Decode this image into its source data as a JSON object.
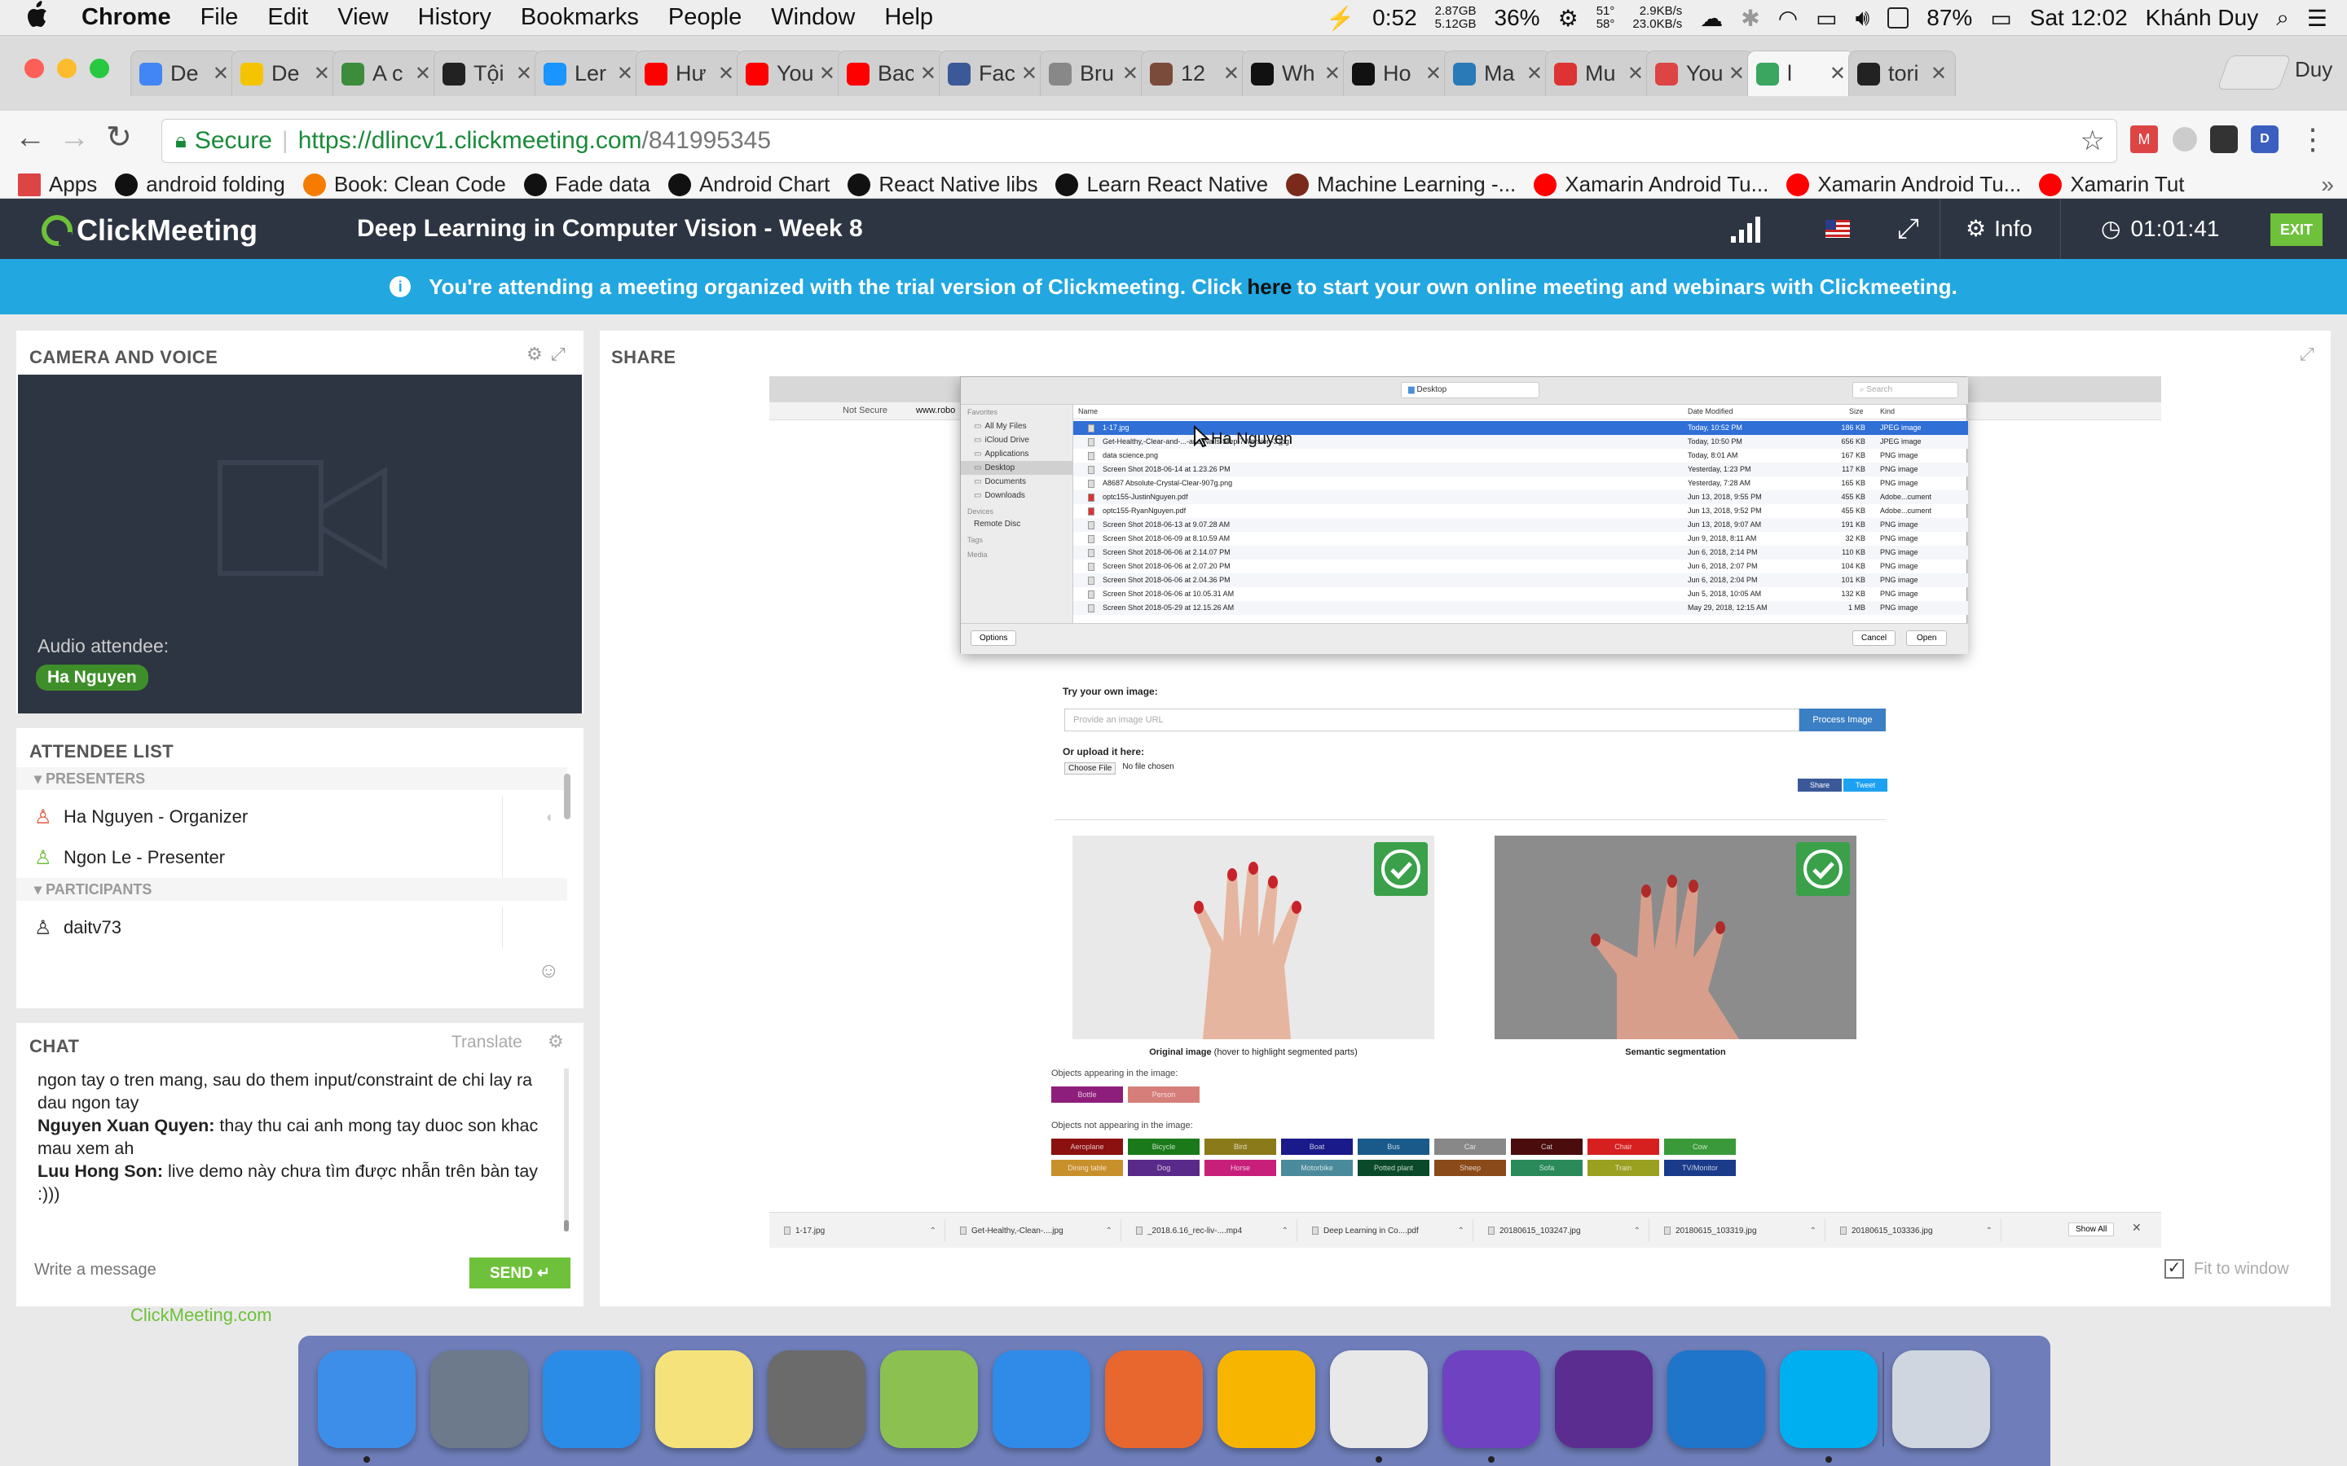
{
  "menubar": {
    "app": "Chrome",
    "items": [
      "File",
      "Edit",
      "View",
      "History",
      "Bookmarks",
      "People",
      "Window",
      "Help"
    ],
    "battery_time": "0:52",
    "mem_top": "2.87GB",
    "mem_bottom": "5.12GB",
    "cpu": "36%",
    "temp_top": "51°",
    "temp_bottom": "58°",
    "net_up": "2.9KB/s",
    "net_down": "23.0KB/s",
    "battery": "87%",
    "clock": "Sat 12:02",
    "user": "Khánh Duy"
  },
  "tabs": [
    {
      "title": "De",
      "color": "#4285f4"
    },
    {
      "title": "De",
      "color": "#f5c400"
    },
    {
      "title": "A c",
      "color": "#3c8c3c"
    },
    {
      "title": "Tội",
      "color": "#222222"
    },
    {
      "title": "Ler",
      "color": "#1a94ff"
    },
    {
      "title": "Hư",
      "color": "#ff0000"
    },
    {
      "title": "You",
      "color": "#ff0000"
    },
    {
      "title": "Bac",
      "color": "#ff0000"
    },
    {
      "title": "Fac",
      "color": "#3b5998"
    },
    {
      "title": "Bru",
      "color": "#888888"
    },
    {
      "title": "12",
      "color": "#7a4a3a"
    },
    {
      "title": "Wh",
      "color": "#111111"
    },
    {
      "title": "Ho",
      "color": "#111111"
    },
    {
      "title": "Ma",
      "color": "#2a7ab8"
    },
    {
      "title": "Mu",
      "color": "#d33"
    },
    {
      "title": "You",
      "color": "#d44"
    },
    {
      "title": "l",
      "color": "#3aa660",
      "active": true
    },
    {
      "title": "tori",
      "color": "#222222"
    }
  ],
  "profile": "Duy",
  "url": {
    "secure_label": "Secure",
    "prefix": "https://dlincv1.clickmeeting.com",
    "path": "/841995345"
  },
  "bookmarks": [
    {
      "label": "Apps",
      "color": "#d44"
    },
    {
      "label": "android folding",
      "color": "#111"
    },
    {
      "label": "Book: Clean Code",
      "color": "#f57c00"
    },
    {
      "label": "Fade data",
      "color": "#111"
    },
    {
      "label": "Android Chart",
      "color": "#111"
    },
    {
      "label": "React Native libs",
      "color": "#111"
    },
    {
      "label": "Learn React Native",
      "color": "#111"
    },
    {
      "label": "Machine Learning -...",
      "color": "#7a2a1a"
    },
    {
      "label": "Xamarin Android Tu...",
      "color": "#ff0000"
    },
    {
      "label": "Xamarin Android Tu...",
      "color": "#ff0000"
    },
    {
      "label": "Xamarin Tut",
      "color": "#ff0000"
    }
  ],
  "app": {
    "logo": "ClickMeeting",
    "title": "Deep Learning in Computer Vision - Week 8",
    "info": "Info",
    "timer": "01:01:41",
    "exit": "EXIT"
  },
  "banner": {
    "before": "You're attending a meeting organized with the trial version of Clickmeeting. Click ",
    "link": "here",
    "after": " to start your own online meeting and webinars with Clickmeeting."
  },
  "camera": {
    "header": "CAMERA AND VOICE",
    "audio_label": "Audio attendee:",
    "audio_name": "Ha Nguyen"
  },
  "attendees": {
    "header": "ATTENDEE LIST",
    "presenters_label": "PRESENTERS",
    "participants_label": "PARTICIPANTS",
    "presenters": [
      "Ha Nguyen - Organizer",
      "Ngon Le - Presenter"
    ],
    "participants": [
      "daitv73"
    ]
  },
  "chat": {
    "header": "CHAT",
    "translate": "Translate",
    "placeholder": "Write a message",
    "send": "SEND",
    "messages": [
      {
        "author": "",
        "text": "ngon tay o tren mang, sau do them input/constraint de chi lay ra dau ngon tay"
      },
      {
        "author": "Nguyen Xuan Quyen:",
        "text": " thay thu cai anh mong tay duoc son khac mau xem ah"
      },
      {
        "author": "Luu Hong Son:",
        "text": " live demo này chưa tìm được nhẫn trên bàn tay :)))"
      }
    ]
  },
  "footer": {
    "link": "ClickMeeting.com"
  },
  "share": {
    "header": "SHARE",
    "fit_to_window": "Fit to window",
    "cursor_label": "Ha Nguyen",
    "dialog": {
      "location": "Desktop",
      "search_placeholder": "Search",
      "sidebar_favorites": "Favorites",
      "sidebar_items": [
        "All My Files",
        "iCloud Drive",
        "Applications",
        "Desktop",
        "Documents",
        "Downloads"
      ],
      "sidebar_devices": "Devices",
      "sidebar_device_item": "Remote Disc",
      "sidebar_tags": "Tags",
      "sidebar_media": "Media",
      "col_name": "Name",
      "col_date": "Date Modified",
      "col_size": "Size",
      "col_kind": "Kind",
      "files": [
        {
          "name": "1-17.jpg",
          "date": "Today, 10:52 PM",
          "size": "186 KB",
          "kind": "JPEG image",
          "selected": true
        },
        {
          "name": "Get-Healthy,-Clear-and-...-and-Nails-Step-7-Version-3.jpg",
          "date": "Today, 10:50 PM",
          "size": "656 KB",
          "kind": "JPEG image"
        },
        {
          "name": "data science.png",
          "date": "Today, 8:01 AM",
          "size": "167 KB",
          "kind": "PNG image"
        },
        {
          "name": "Screen Shot 2018-06-14 at 1.23.26 PM",
          "date": "Yesterday, 1:23 PM",
          "size": "117 KB",
          "kind": "PNG image"
        },
        {
          "name": "A8687 Absolute-Crystal-Clear-907g.png",
          "date": "Yesterday, 7:28 AM",
          "size": "165 KB",
          "kind": "PNG image"
        },
        {
          "name": "optc155-JustinNguyen.pdf",
          "date": "Jun 13, 2018, 9:55 PM",
          "size": "455 KB",
          "kind": "Adobe...cument"
        },
        {
          "name": "optc155-RyanNguyen.pdf",
          "date": "Jun 13, 2018, 9:52 PM",
          "size": "455 KB",
          "kind": "Adobe...cument"
        },
        {
          "name": "Screen Shot 2018-06-13 at 9.07.28 AM",
          "date": "Jun 13, 2018, 9:07 AM",
          "size": "191 KB",
          "kind": "PNG image"
        },
        {
          "name": "Screen Shot 2018-06-09 at 8.10.59 AM",
          "date": "Jun 9, 2018, 8:11 AM",
          "size": "32 KB",
          "kind": "PNG image"
        },
        {
          "name": "Screen Shot 2018-06-06 at 2.14.07 PM",
          "date": "Jun 6, 2018, 2:14 PM",
          "size": "110 KB",
          "kind": "PNG image"
        },
        {
          "name": "Screen Shot 2018-06-06 at 2.07.20 PM",
          "date": "Jun 6, 2018, 2:07 PM",
          "size": "104 KB",
          "kind": "PNG image"
        },
        {
          "name": "Screen Shot 2018-06-06 at 2.04.36 PM",
          "date": "Jun 6, 2018, 2:04 PM",
          "size": "101 KB",
          "kind": "PNG image"
        },
        {
          "name": "Screen Shot 2018-06-06 at 10.05.31 AM",
          "date": "Jun 5, 2018, 10:05 AM",
          "size": "132 KB",
          "kind": "PNG image"
        },
        {
          "name": "Screen Shot 2018-05-29 at 12.15.26 AM",
          "date": "May 29, 2018, 12:15 AM",
          "size": "1 MB",
          "kind": "PNG image"
        }
      ],
      "options": "Options",
      "cancel": "Cancel",
      "open": "Open"
    },
    "page": {
      "browser_url_prefix": "Not Secure",
      "browser_url": "www.robo",
      "try_label": "Try your own image:",
      "url_placeholder": "Provide an image URL",
      "process_button": "Process Image",
      "upload_label": "Or upload it here:",
      "choose_file": "Choose File",
      "no_file": "No file chosen",
      "share_fb": "Share",
      "share_tw": "Tweet",
      "orig_caption_bold": "Original image",
      "orig_caption_rest": " (hover to highlight segmented parts)",
      "seg_caption": "Semantic segmentation",
      "appearing_label": "Objects appearing in the image:",
      "appearing": [
        {
          "label": "Bottle",
          "color": "#8e1e7c"
        },
        {
          "label": "Person",
          "color": "#d67f7a"
        }
      ],
      "not_appearing_label": "Objects not appearing in the image:",
      "not_appearing": [
        {
          "label": "Aeroplane",
          "color": "#8b1010"
        },
        {
          "label": "Bicycle",
          "color": "#1a7a1a"
        },
        {
          "label": "Bird",
          "color": "#8a7a1a"
        },
        {
          "label": "Boat",
          "color": "#1a1a8a"
        },
        {
          "label": "Bus",
          "color": "#1a5a8a"
        },
        {
          "label": "Car",
          "color": "#888888"
        },
        {
          "label": "Cat",
          "color": "#4a0c0c"
        },
        {
          "label": "Chair",
          "color": "#d62020"
        },
        {
          "label": "Cow",
          "color": "#3a9a3a"
        },
        {
          "label": "Dining table",
          "color": "#c8902a"
        },
        {
          "label": "Dog",
          "color": "#5a2a8a"
        },
        {
          "label": "Horse",
          "color": "#c8207a"
        },
        {
          "label": "Motorbike",
          "color": "#4a8a9a"
        },
        {
          "label": "Potted plant",
          "color": "#0a4a2a"
        },
        {
          "label": "Sheep",
          "color": "#8a4a1a"
        },
        {
          "label": "Sofa",
          "color": "#2a8a5a"
        },
        {
          "label": "Train",
          "color": "#9aa020"
        },
        {
          "label": "TV/Monitor",
          "color": "#1a3a8a"
        }
      ],
      "downloads": [
        "1-17.jpg",
        "Get-Healthy,-Clean-....jpg",
        "_2018.6.16_rec-liv-....mp4",
        "Deep Learning in Co....pdf",
        "20180615_103247.jpg",
        "20180615_103319.jpg",
        "20180615_103336.jpg"
      ],
      "show_all": "Show All"
    }
  },
  "dock": [
    {
      "name": "finder",
      "color": "#3d8ee8",
      "running": true
    },
    {
      "name": "launchpad",
      "color": "#6c7a8c"
    },
    {
      "name": "itunes",
      "color": "#2b8ce8"
    },
    {
      "name": "notes",
      "color": "#f5e27a"
    },
    {
      "name": "system-preferences",
      "color": "#6b6b6b"
    },
    {
      "name": "android-studio",
      "color": "#8cc152"
    },
    {
      "name": "xcode",
      "color": "#2f8ae8"
    },
    {
      "name": "postman",
      "color": "#e8672f"
    },
    {
      "name": "sketch",
      "color": "#f7b500"
    },
    {
      "name": "chrome",
      "color": "#e8e8e8",
      "running": true
    },
    {
      "name": "github-desktop",
      "color": "#6f42c1",
      "running": true
    },
    {
      "name": "visual-studio",
      "color": "#5c2d91"
    },
    {
      "name": "vscode",
      "color": "#1f75c9"
    },
    {
      "name": "skype",
      "color": "#00aff0",
      "running": true
    },
    {
      "name": "trash",
      "color": "#cfd6df"
    }
  ]
}
